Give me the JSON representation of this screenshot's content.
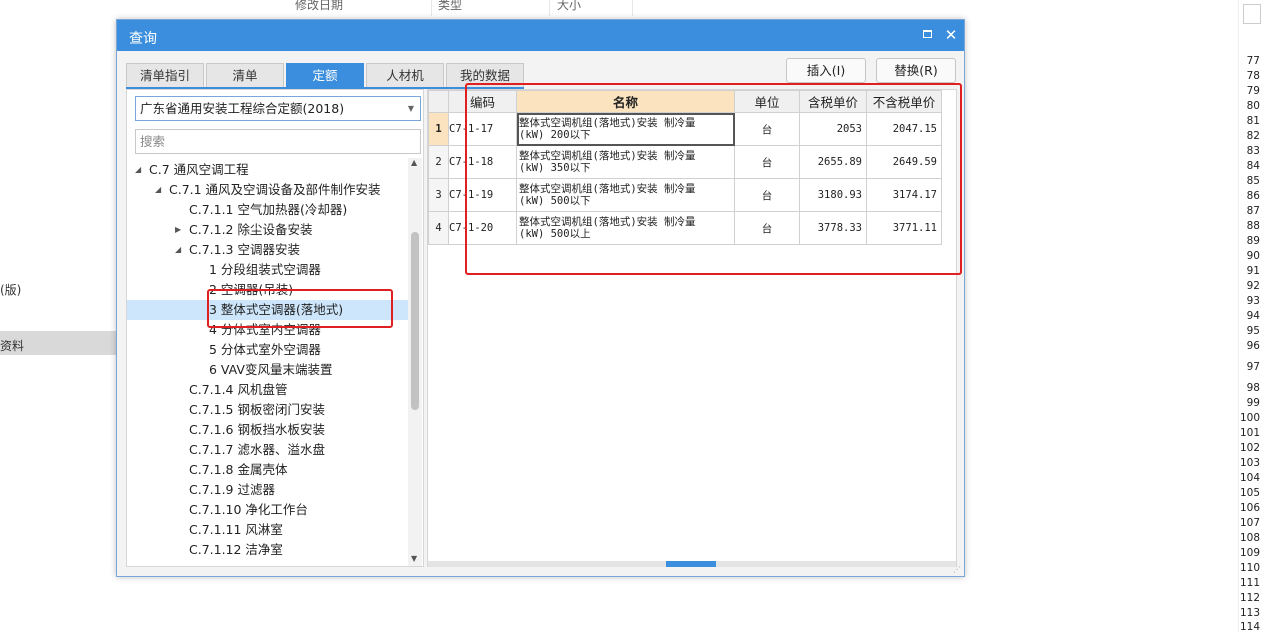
{
  "background": {
    "headers": [
      "修改日期",
      "类型",
      "大小"
    ],
    "left_texts": [
      "(版)",
      "资料"
    ],
    "row_numbers": [
      "77",
      "78",
      "79",
      "80",
      "81",
      "82",
      "83",
      "84",
      "85",
      "86",
      "87",
      "88",
      "89",
      "90",
      "91",
      "92",
      "93",
      "94",
      "95",
      "96",
      "97",
      "98",
      "99",
      "100",
      "101",
      "102",
      "103",
      "104",
      "105",
      "106",
      "107",
      "108",
      "109",
      "110",
      "111",
      "112",
      "113",
      "114"
    ]
  },
  "dialog": {
    "title": "查询",
    "tabs": [
      {
        "label": "清单指引",
        "active": false
      },
      {
        "label": "清单",
        "active": false
      },
      {
        "label": "定额",
        "active": true
      },
      {
        "label": "人材机",
        "active": false
      },
      {
        "label": "我的数据",
        "active": false
      }
    ],
    "insert_button": "插入(I)",
    "replace_button": "替换(R)",
    "library_select": "广东省通用安装工程综合定额(2018)",
    "search_placeholder": "搜索",
    "tree": [
      {
        "label": "C.7 通风空调工程",
        "indent": 0,
        "arrow": "down"
      },
      {
        "label": "C.7.1 通风及空调设备及部件制作安装",
        "indent": 1,
        "arrow": "down"
      },
      {
        "label": "C.7.1.1 空气加热器(冷却器)",
        "indent": 2,
        "arrow": ""
      },
      {
        "label": "C.7.1.2 除尘设备安装",
        "indent": 2,
        "arrow": "right"
      },
      {
        "label": "C.7.1.3 空调器安装",
        "indent": 2,
        "arrow": "down"
      },
      {
        "label": "1 分段组装式空调器",
        "indent": 3,
        "arrow": ""
      },
      {
        "label": "2 空调器(吊装)",
        "indent": 3,
        "arrow": ""
      },
      {
        "label": "3 整体式空调器(落地式)",
        "indent": 3,
        "arrow": "",
        "selected": true
      },
      {
        "label": "4 分体式室内空调器",
        "indent": 3,
        "arrow": ""
      },
      {
        "label": "5 分体式室外空调器",
        "indent": 3,
        "arrow": ""
      },
      {
        "label": "6 VAV变风量末端装置",
        "indent": 3,
        "arrow": ""
      },
      {
        "label": "C.7.1.4 风机盘管",
        "indent": 2,
        "arrow": ""
      },
      {
        "label": "C.7.1.5 钢板密闭门安装",
        "indent": 2,
        "arrow": ""
      },
      {
        "label": "C.7.1.6 钢板挡水板安装",
        "indent": 2,
        "arrow": ""
      },
      {
        "label": "C.7.1.7 滤水器、溢水盘",
        "indent": 2,
        "arrow": ""
      },
      {
        "label": "C.7.1.8 金属壳体",
        "indent": 2,
        "arrow": ""
      },
      {
        "label": "C.7.1.9 过滤器",
        "indent": 2,
        "arrow": ""
      },
      {
        "label": "C.7.1.10 净化工作台",
        "indent": 2,
        "arrow": ""
      },
      {
        "label": "C.7.1.11 风淋室",
        "indent": 2,
        "arrow": ""
      },
      {
        "label": "C.7.1.12 洁净室",
        "indent": 2,
        "arrow": ""
      }
    ],
    "grid": {
      "columns": [
        "",
        "编码",
        "名称",
        "单位",
        "含税单价",
        "不含税单价"
      ],
      "rows": [
        {
          "n": "1",
          "code": "C7-1-17",
          "name1": "整体式空调机组(落地式)安装 制冷量",
          "name2": "(kW) 200以下",
          "unit": "台",
          "tax_price": "2053",
          "notax_price": "2047.15"
        },
        {
          "n": "2",
          "code": "C7-1-18",
          "name1": "整体式空调机组(落地式)安装 制冷量",
          "name2": "(kW) 350以下",
          "unit": "台",
          "tax_price": "2655.89",
          "notax_price": "2649.59"
        },
        {
          "n": "3",
          "code": "C7-1-19",
          "name1": "整体式空调机组(落地式)安装 制冷量",
          "name2": "(kW) 500以下",
          "unit": "台",
          "tax_price": "3180.93",
          "notax_price": "3174.17"
        },
        {
          "n": "4",
          "code": "C7-1-20",
          "name1": "整体式空调机组(落地式)安装 制冷量",
          "name2": "(kW) 500以上",
          "unit": "台",
          "tax_price": "3778.33",
          "notax_price": "3771.11"
        }
      ]
    }
  }
}
